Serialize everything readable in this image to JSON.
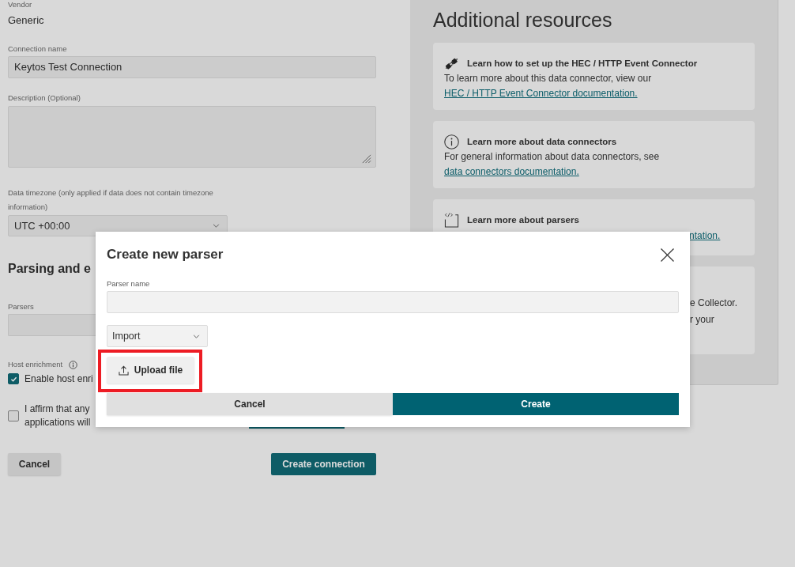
{
  "form": {
    "vendor": {
      "label": "Vendor",
      "value": "Generic"
    },
    "connection_name": {
      "label": "Connection name",
      "value": "Keytos Test Connection"
    },
    "description": {
      "label": "Description (Optional)"
    },
    "timezone": {
      "label": "Data timezone (only applied if data does not contain timezone information)",
      "value": "UTC +00:00"
    },
    "section_title": "Parsing and e",
    "parsers": {
      "label": "Parsers"
    },
    "host_enrichment": {
      "label": "Host enrichment"
    },
    "checkboxes": [
      {
        "lines": [
          "Enable host enri"
        ],
        "checked": true
      },
      {
        "lines": [
          "I affirm that any",
          "applications will"
        ],
        "checked": false
      }
    ],
    "buttons": [
      {
        "label": "Cancel",
        "kind": "secondary"
      },
      {
        "label": "Create connection",
        "kind": "primary"
      }
    ]
  },
  "resources": {
    "title": "Additional resources",
    "cards": [
      {
        "kind": "full",
        "title": "Learn how to set up the HEC / HTTP Event Connector",
        "text": "To learn more about this data connector, view our",
        "link": "HEC / HTTP Event Connector documentation."
      },
      {
        "kind": "full",
        "title": "Learn more about data connectors",
        "text": "For general information about data connectors, see",
        "link": "data connectors documentation."
      },
      {
        "kind": "cut",
        "title": "Learn more about parsers",
        "link": "ntation."
      },
      {
        "kind": "fragments",
        "lines": [
          "e Collector.",
          "r your"
        ]
      }
    ]
  },
  "modal": {
    "title": "Create new parser",
    "parser_name": {
      "label": "Parser name"
    },
    "source_select": {
      "value": "Import"
    },
    "upload_button": {
      "label": "Upload file",
      "highlighted": true
    },
    "buttons": [
      {
        "label": "Cancel",
        "kind": "secondary"
      },
      {
        "label": "Create",
        "kind": "primary"
      }
    ]
  }
}
